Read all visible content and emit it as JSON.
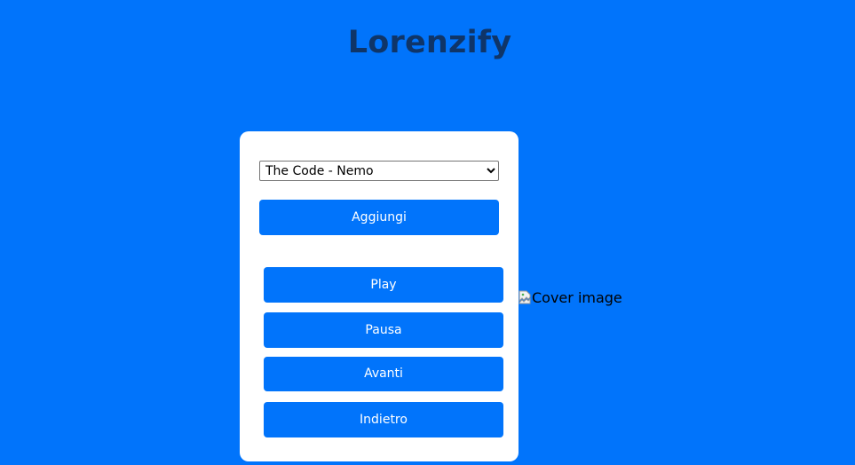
{
  "app": {
    "title": "Lorenzify"
  },
  "player": {
    "song_select": {
      "selected": "The Code - Nemo",
      "options": [
        "The Code - Nemo"
      ]
    },
    "add_label": "Aggiungi",
    "controls": {
      "play_label": "Play",
      "pause_label": "Pausa",
      "next_label": "Avanti",
      "prev_label": "Indietro"
    }
  },
  "cover": {
    "alt": "Cover image",
    "icon": "broken-image-icon"
  },
  "colors": {
    "background": "#0174fb",
    "title": "#0f3568",
    "card": "#ffffff",
    "button": "#0174fb",
    "button_text": "#ffffff"
  }
}
